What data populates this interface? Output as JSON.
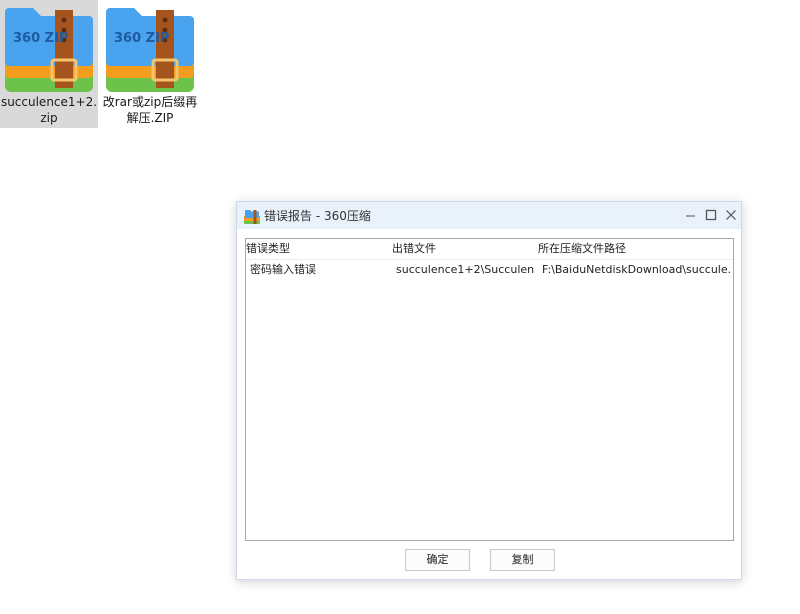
{
  "desktop": {
    "icons": [
      {
        "name": "succulence1+2.zip",
        "logo_text": "360 ZIP",
        "selected": true
      },
      {
        "name": "改rar或zip后缀再解压.ZIP",
        "logo_text": "360 ZIP",
        "selected": false
      }
    ]
  },
  "dialog": {
    "title": "错误报告 - 360压缩",
    "window_controls": {
      "minimize": "minimize-icon",
      "maximize": "maximize-icon",
      "close": "close-icon"
    },
    "columns": [
      "错误类型",
      "出错文件",
      "所在压缩文件路径"
    ],
    "rows": [
      {
        "error_type": "密码输入错误",
        "error_file": "succulence1+2\\Succulen...",
        "archive_path": "F:\\BaiduNetdiskDownload\\succule..."
      }
    ],
    "buttons": {
      "ok": "确定",
      "copy": "复制"
    }
  },
  "colors": {
    "titlebar": "#e9f1fb",
    "zip_blue": "#4aa3ee",
    "zip_orange": "#f39c1e",
    "zip_green": "#6cc24a",
    "zip_strap": "#a5541e",
    "selection": "#d9d9d9"
  }
}
